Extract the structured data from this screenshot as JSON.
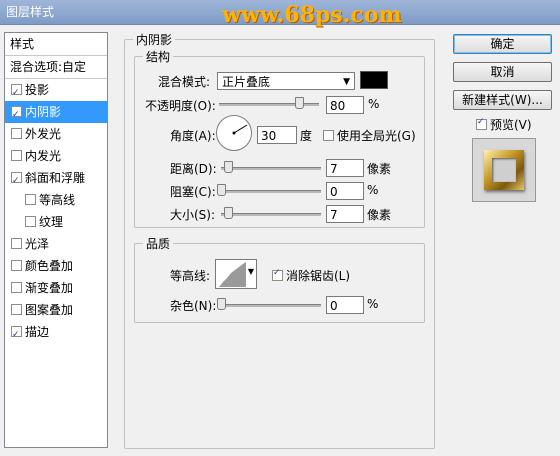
{
  "window": {
    "title": "图层样式",
    "watermark": "www.68ps.com"
  },
  "styles_panel": {
    "header": "样式",
    "blend_options": "混合选项:自定",
    "items": [
      {
        "label": "投影",
        "checked": true,
        "sub": false
      },
      {
        "label": "内阴影",
        "checked": true,
        "sub": false,
        "selected": true
      },
      {
        "label": "外发光",
        "checked": false,
        "sub": false
      },
      {
        "label": "内发光",
        "checked": false,
        "sub": false
      },
      {
        "label": "斜面和浮雕",
        "checked": true,
        "sub": false
      },
      {
        "label": "等高线",
        "checked": false,
        "sub": true
      },
      {
        "label": "纹理",
        "checked": false,
        "sub": true
      },
      {
        "label": "光泽",
        "checked": false,
        "sub": false
      },
      {
        "label": "颜色叠加",
        "checked": false,
        "sub": false
      },
      {
        "label": "渐变叠加",
        "checked": false,
        "sub": false
      },
      {
        "label": "图案叠加",
        "checked": false,
        "sub": false
      },
      {
        "label": "描边",
        "checked": true,
        "sub": false
      }
    ]
  },
  "inner_shadow": {
    "title": "内阴影",
    "structure": {
      "title": "结构",
      "blend_mode_label": "混合模式:",
      "blend_mode_value": "正片叠底",
      "color": "#000000",
      "opacity_label": "不透明度(O):",
      "opacity_value": "80",
      "opacity_unit": "%",
      "opacity_fraction": 0.8,
      "angle_label": "角度(A):",
      "angle_value": "30",
      "angle_unit": "度",
      "global_light_label": "使用全局光(G)",
      "global_light_checked": false,
      "distance_label": "距离(D):",
      "distance_value": "7",
      "distance_unit": "像素",
      "choke_label": "阻塞(C):",
      "choke_value": "0",
      "choke_unit": "%",
      "size_label": "大小(S):",
      "size_value": "7",
      "size_unit": "像素"
    },
    "quality": {
      "title": "品质",
      "contour_label": "等高线:",
      "anti_alias_label": "消除锯齿(L)",
      "anti_alias_checked": true,
      "noise_label": "杂色(N):",
      "noise_value": "0",
      "noise_unit": "%"
    }
  },
  "buttons": {
    "ok": "确定",
    "cancel": "取消",
    "new_style": "新建样式(W)...",
    "preview": "预览(V)",
    "preview_checked": true
  }
}
